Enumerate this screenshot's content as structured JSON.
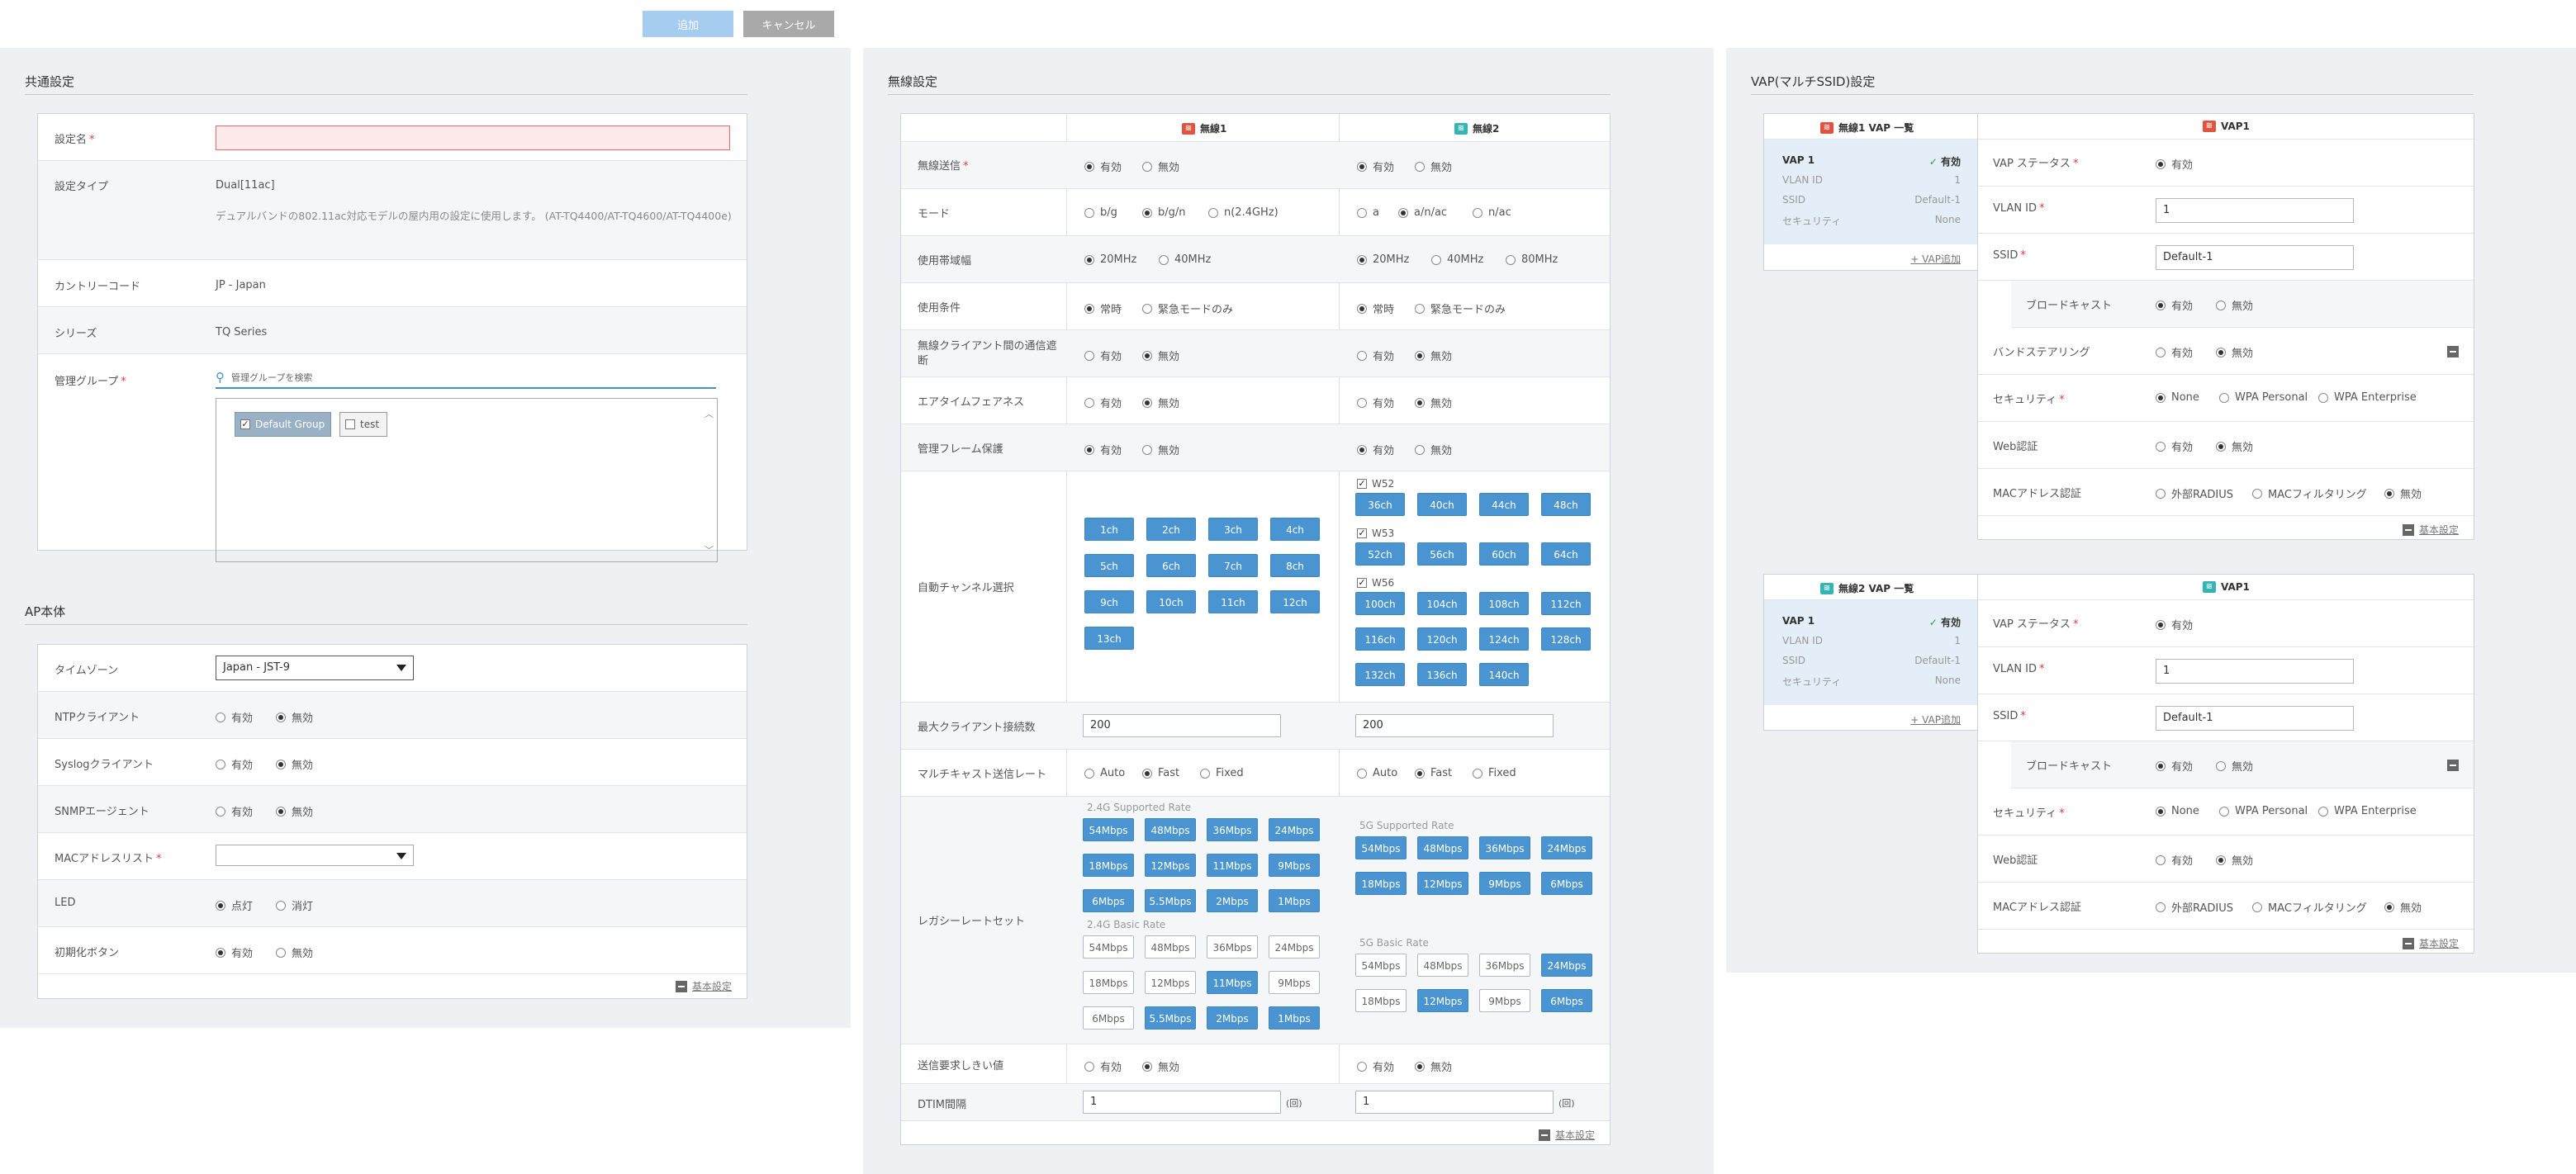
{
  "toolbar": {
    "add_label": "追加",
    "cancel_label": "キャンセル"
  },
  "common": {
    "title": "共通設定",
    "name_label": "設定名",
    "req": "*",
    "type_label": "設定タイプ",
    "type_value": "Dual[11ac]",
    "type_note": "デュアルバンドの802.11ac対応モデルの屋内用の設定に使用します。 (AT-TQ4400/AT-TQ4600/AT-TQ4400e)",
    "country_label": "カントリーコード",
    "country_value": "JP - Japan",
    "series_label": "シリーズ",
    "series_value": "TQ Series",
    "group_label": "管理グループ",
    "group_search_placeholder": "管理グループを検索",
    "groups": [
      {
        "label": "Default Group",
        "checked": true
      },
      {
        "label": "test",
        "checked": false
      }
    ]
  },
  "ap": {
    "title": "AP本体",
    "timezone_label": "タイムゾーン",
    "timezone_value": "Japan - JST-9",
    "ntp_label": "NTPクライアント",
    "syslog_label": "Syslogクライアント",
    "snmp_label": "SNMPエージェント",
    "mac_label": "MACアドレスリスト",
    "mac_value": "",
    "led_label": "LED",
    "led_on": "点灯",
    "led_off": "消灯",
    "reset_label": "初期化ボタン",
    "on": "有効",
    "off": "無効",
    "footer": "基本設定"
  },
  "wireless": {
    "title": "無線設定",
    "radio1": "無線1",
    "radio2": "無線2",
    "rows": {
      "tx": "無線送信",
      "mode": "モード",
      "bw": "使用帯域幅",
      "cond": "使用条件",
      "isolation": "無線クライアント間の通信遮断",
      "airtime": "エアタイムフェアネス",
      "pmf": "管理フレーム保護",
      "auto_ch": "自動チャンネル選択",
      "max_clients": "最大クライアント接続数",
      "mcast": "マルチキャスト送信レート",
      "legacy": "レガシーレートセット",
      "rts": "送信要求しきい値",
      "dtim": "DTIM間隔"
    },
    "on": "有効",
    "off": "無効",
    "mode1": [
      "b/g",
      "b/g/n",
      "n(2.4GHz)"
    ],
    "mode2": [
      "a",
      "a/n/ac",
      "n/ac"
    ],
    "bw1": [
      "20MHz",
      "40MHz"
    ],
    "bw2": [
      "20MHz",
      "40MHz",
      "80MHz"
    ],
    "cond_always": "常時",
    "cond_emergency": "緊急モードのみ",
    "ch1": [
      "1ch",
      "2ch",
      "3ch",
      "4ch",
      "5ch",
      "6ch",
      "7ch",
      "8ch",
      "9ch",
      "10ch",
      "11ch",
      "12ch",
      "13ch"
    ],
    "w52_label": "W52",
    "w52": [
      "36ch",
      "40ch",
      "44ch",
      "48ch"
    ],
    "w53_label": "W53",
    "w53": [
      "52ch",
      "56ch",
      "60ch",
      "64ch"
    ],
    "w56_label": "W56",
    "w56": [
      "100ch",
      "104ch",
      "108ch",
      "112ch",
      "116ch",
      "120ch",
      "124ch",
      "128ch",
      "132ch",
      "136ch",
      "140ch"
    ],
    "max_clients1": "200",
    "max_clients2": "200",
    "mcast_opts": [
      "Auto",
      "Fast",
      "Fixed"
    ],
    "supported24_label": "2.4G Supported Rate",
    "supported24": [
      "54Mbps",
      "48Mbps",
      "36Mbps",
      "24Mbps",
      "18Mbps",
      "12Mbps",
      "11Mbps",
      "9Mbps",
      "6Mbps",
      "5.5Mbps",
      "2Mbps",
      "1Mbps"
    ],
    "basic24_label": "2.4G Basic Rate",
    "basic24_on": [
      false,
      false,
      false,
      false,
      false,
      false,
      true,
      false,
      false,
      true,
      true,
      true
    ],
    "supported5_label": "5G Supported Rate",
    "supported5": [
      "54Mbps",
      "48Mbps",
      "36Mbps",
      "24Mbps",
      "18Mbps",
      "12Mbps",
      "9Mbps",
      "6Mbps"
    ],
    "basic5_label": "5G Basic Rate",
    "basic5_on": [
      false,
      false,
      false,
      true,
      false,
      true,
      false,
      true
    ],
    "dtim1": "1",
    "dtim2": "1",
    "dtim_unit": "(回)",
    "footer": "基本設定"
  },
  "vap": {
    "title": "VAP(マルチSSID)設定",
    "blocks": [
      {
        "list_title": "無線1  VAP 一覧",
        "radio": "r",
        "vap_name": "VAP 1",
        "status": "有効",
        "vlan_label": "VLAN ID",
        "vlan": "1",
        "ssid_label": "SSID",
        "ssid": "Default-1",
        "sec_label": "セキュリティ",
        "sec": "None",
        "add": "VAP追加",
        "detail_title": "VAP1",
        "status_label": "VAP ステータス",
        "vlan_field": "1",
        "ssid_field": "Default-1",
        "broadcast_label": "ブロードキャスト",
        "band_label": "バンドステアリング",
        "security_label": "セキュリティ",
        "web_label": "Web認証",
        "mac_label": "MACアドレス認証",
        "footer": "基本設定"
      },
      {
        "list_title": "無線2  VAP 一覧",
        "radio": "t",
        "vap_name": "VAP 1",
        "status": "有効",
        "vlan_label": "VLAN ID",
        "vlan": "1",
        "ssid_label": "SSID",
        "ssid": "Default-1",
        "sec_label": "セキュリティ",
        "sec": "None",
        "add": "VAP追加",
        "detail_title": "VAP1",
        "status_label": "VAP ステータス",
        "vlan_field": "1",
        "ssid_field": "Default-1",
        "broadcast_label": "ブロードキャスト",
        "security_label": "セキュリティ",
        "web_label": "Web認証",
        "mac_label": "MACアドレス認証",
        "footer": "基本設定"
      }
    ],
    "on": "有効",
    "off": "無効",
    "sec_opts": [
      "None",
      "WPA Personal",
      "WPA Enterprise"
    ],
    "mac_opts": [
      "外部RADIUS",
      "MACフィルタリング",
      "無効"
    ]
  }
}
